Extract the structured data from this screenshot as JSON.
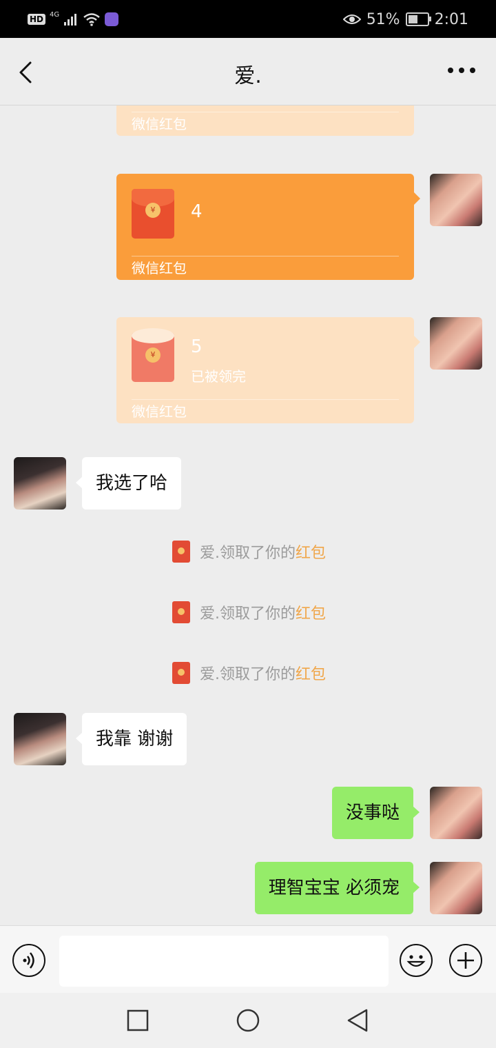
{
  "status_bar": {
    "hd": "HD",
    "network": "4G",
    "battery": "51%",
    "battery_level": 0.51,
    "time": "2:01"
  },
  "header": {
    "title": "爱."
  },
  "messages": {
    "rp0": {
      "footer": "微信红包"
    },
    "rp1": {
      "amount": "4",
      "footer": "微信红包",
      "state": "unopened"
    },
    "rp2": {
      "amount": "5",
      "status": "已被领完",
      "footer": "微信红包",
      "state": "claimed"
    },
    "msg3": {
      "text": "我选了哈"
    },
    "sys1": {
      "prefix": "爱.领取了你的",
      "highlight": "红包"
    },
    "sys2": {
      "prefix": "爱.领取了你的",
      "highlight": "红包"
    },
    "sys3": {
      "prefix": "爱.领取了你的",
      "highlight": "红包"
    },
    "msg4": {
      "text": "我靠 谢谢"
    },
    "msg5": {
      "text": "没事哒"
    },
    "msg6": {
      "text": "理智宝宝 必须宠"
    }
  },
  "input": {
    "value": "",
    "placeholder": ""
  },
  "colors": {
    "red_packet": "#fa9d3b",
    "red_packet_claimed": "#fde1c2",
    "my_bubble": "#95ec69",
    "their_bubble": "#ffffff",
    "highlight": "#f0a64a",
    "background": "#ededed"
  },
  "icons": {
    "back": "chevron-left-icon",
    "more": "more-dots-icon",
    "voice": "voice-icon",
    "emoji": "emoji-icon",
    "plus": "plus-icon",
    "nav_recent": "square-icon",
    "nav_home": "circle-icon",
    "nav_back": "triangle-back-icon"
  }
}
